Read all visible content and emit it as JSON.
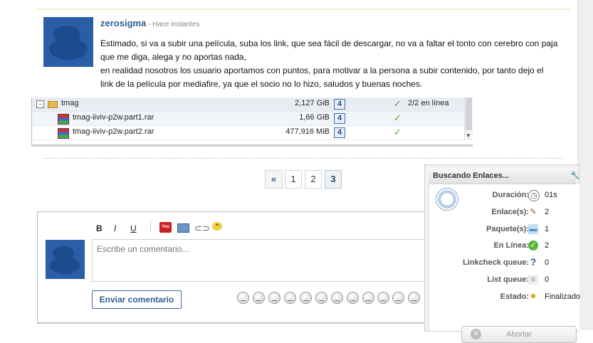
{
  "comment": {
    "author": "zerosigma",
    "time": " - Hace instantes",
    "lines": [
      "Estimado, si va a subir una película, suba los link, que sea fácil de descargar, no va a faltar el tonto con cerebro con paja",
      "que me diga, alega y no aportas nada,",
      "en realidad nosotros los usuario aportamos con puntos, para motivar a la persona a subir contenido, por tanto dejo el",
      "link de la película por mediafire, ya que el socio no lo hizo, saludos y buenas noches."
    ]
  },
  "downloads": {
    "rows": [
      {
        "expander": "-",
        "name": "tmag",
        "size": "2,127 GiB",
        "hoster": "4",
        "check": "✓",
        "status": "2/2 en línea"
      },
      {
        "name": "tmag-iiviv-p2w.part1.rar",
        "size": "1,66 GiB",
        "hoster": "4",
        "check": "✓",
        "status": ""
      },
      {
        "name": "tmag-iiviv-p2w.part2.rar",
        "size": "477,916 MiB",
        "hoster": "4",
        "check": "✓",
        "status": ""
      }
    ]
  },
  "pagination": {
    "prev": "«",
    "pages": [
      "1",
      "2",
      "3"
    ],
    "current": "3"
  },
  "editor": {
    "bold": "B",
    "italic": "I",
    "underline": "U",
    "youtube_text": "You Tube",
    "placeholder": "Escribe un comentario...",
    "send_label": "Enviar comentario",
    "emoticons": [
      "smile",
      "grin",
      "happy",
      "cool",
      "surprised",
      "sad",
      "devil",
      "wink",
      "angry",
      "shocked",
      "neutral",
      "tongue"
    ]
  },
  "linkcheck": {
    "title": "Buscando Enlaces...",
    "rows": [
      {
        "label": "Duración:",
        "icon": "clock-icon",
        "glyph": "◷",
        "value": "01s"
      },
      {
        "label": "Enlace(s):",
        "icon": "links-icon",
        "glyph": "✎",
        "value": "2"
      },
      {
        "label": "Paquete(s):",
        "icon": "package-folder-icon",
        "glyph": "▬",
        "value": "1"
      },
      {
        "label": "En Línea:",
        "icon": "online-check-icon",
        "glyph": "✓",
        "value": "2"
      },
      {
        "label": "Linkcheck queue:",
        "icon": "question-icon",
        "glyph": "?",
        "value": "0"
      },
      {
        "label": "List queue:",
        "icon": "database-icon",
        "glyph": "≡",
        "value": "0"
      },
      {
        "label": "Estado:",
        "icon": "status-gear-icon",
        "glyph": "✹",
        "value": "Finalizado"
      }
    ],
    "abort_label": "Abortar",
    "abort_icon_glyph": "✕"
  }
}
